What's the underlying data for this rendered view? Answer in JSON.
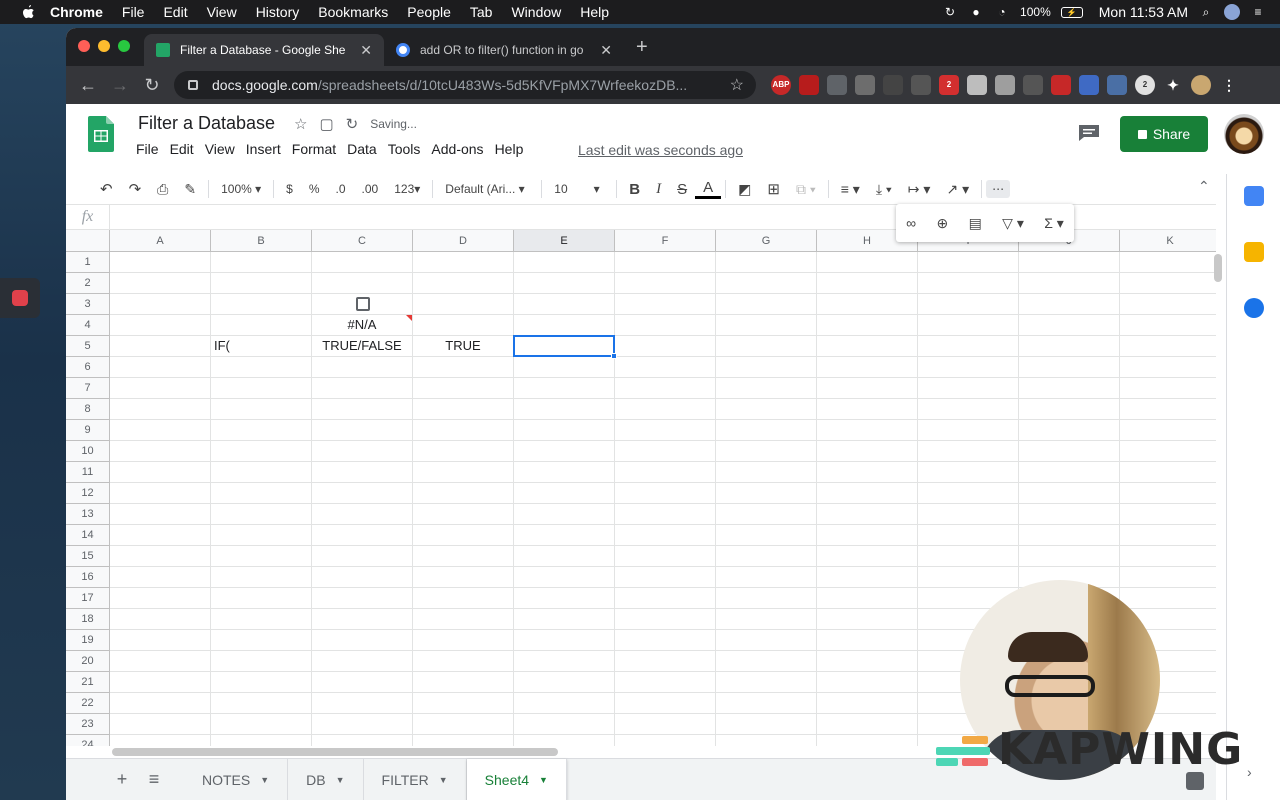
{
  "os_menubar": {
    "app_name": "Chrome",
    "items": [
      "File",
      "Edit",
      "View",
      "History",
      "Bookmarks",
      "People",
      "Tab",
      "Window",
      "Help"
    ],
    "battery": "100%",
    "clock": "Mon 11:53 AM"
  },
  "browser": {
    "tabs": [
      {
        "title": "Filter a Database - Google She"
      },
      {
        "title": "add OR to filter() function in go"
      }
    ],
    "url_host": "docs.google.com",
    "url_path": "/spreadsheets/d/10tcU483Ws-5d5KfVFpMX7WrfeekozDB...",
    "extension_badges": [
      "ABP",
      "2",
      "2"
    ]
  },
  "doc": {
    "title": "Filter a Database",
    "saving": "Saving...",
    "menu": [
      "File",
      "Edit",
      "View",
      "Insert",
      "Format",
      "Data",
      "Tools",
      "Add-ons",
      "Help"
    ],
    "last_edit": "Last edit was seconds ago",
    "share_label": "Share"
  },
  "format_toolbar": {
    "zoom": "100%",
    "currency": "$",
    "percent": "%",
    "decrease_decimal": ".0",
    "increase_decimal": ".00",
    "more_formats": "123",
    "font": "Default (Ari...",
    "font_size": "10",
    "bold": "B",
    "italic": "I",
    "strike": "S",
    "text_color": "A",
    "more": "⋯"
  },
  "formula_bar": {
    "fx": "fx",
    "value": ""
  },
  "sheet": {
    "columns": [
      "A",
      "B",
      "C",
      "D",
      "E",
      "F",
      "G",
      "H",
      "I",
      "J",
      "K"
    ],
    "rows": [
      "1",
      "2",
      "3",
      "4",
      "5",
      "6",
      "7",
      "8",
      "9",
      "10",
      "11",
      "12",
      "13",
      "14",
      "15",
      "16",
      "17",
      "18",
      "19",
      "20",
      "21",
      "22",
      "23",
      "24"
    ],
    "selected_column": "E",
    "selected_cell": "E5",
    "cells": {
      "C4": "#N/A",
      "B5": "IF(",
      "C5": "TRUE/FALSE",
      "D5": "TRUE"
    },
    "checkbox_cell": "C3",
    "error_cell": "C4"
  },
  "sheet_tabs": [
    {
      "name": "NOTES",
      "active": false
    },
    {
      "name": "DB",
      "active": false
    },
    {
      "name": "FILTER",
      "active": false
    },
    {
      "name": "Sheet4",
      "active": true
    }
  ],
  "watermark": {
    "text": "KAPWING"
  },
  "colors": {
    "accent_blue": "#1a73e8",
    "share_green": "#188038",
    "error_red": "#e53935"
  }
}
